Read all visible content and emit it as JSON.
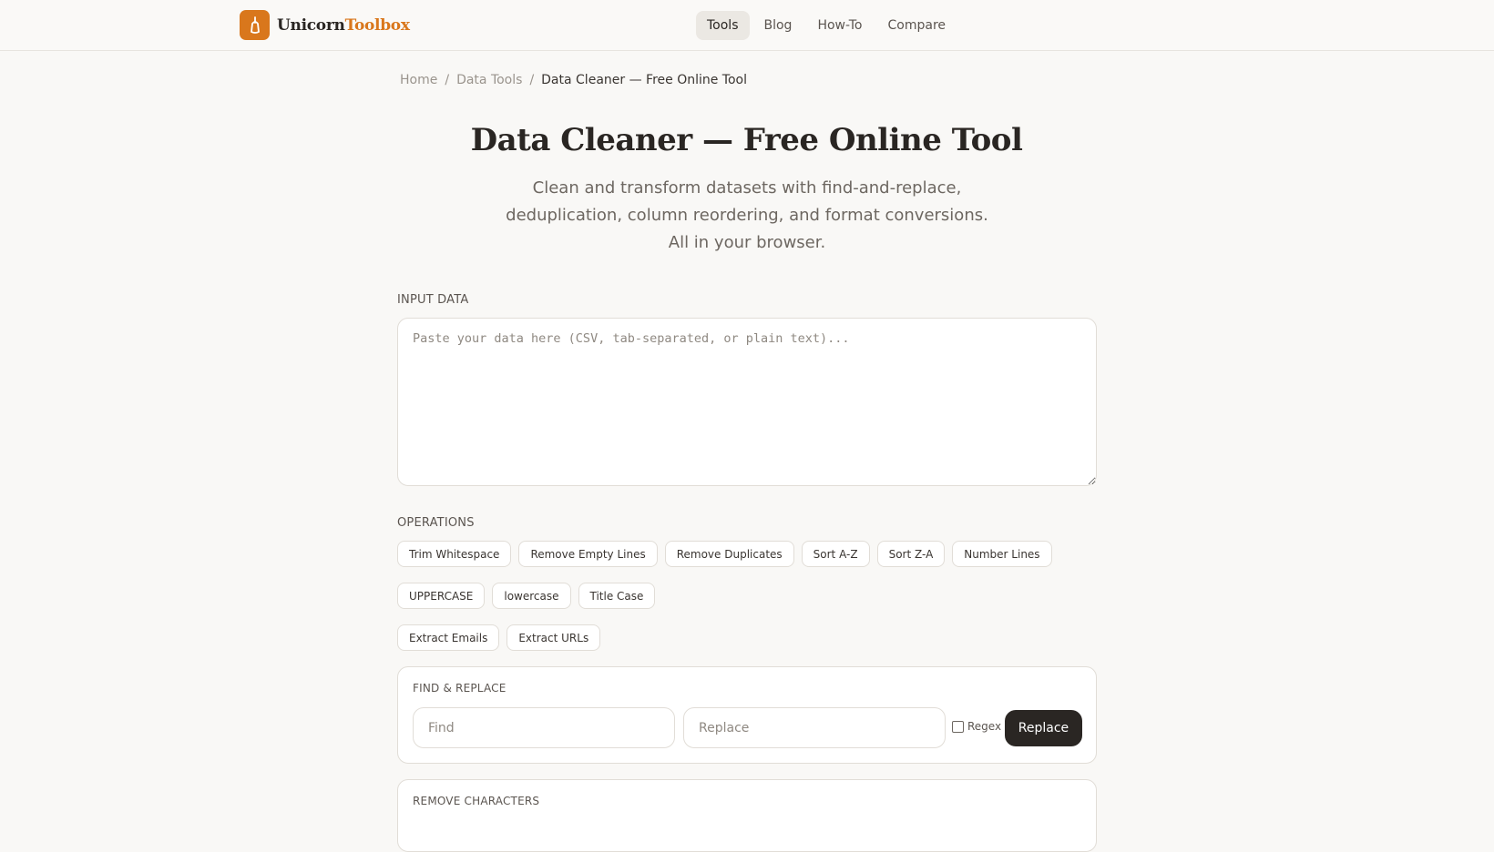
{
  "brand": {
    "name_part1": "Unicorn",
    "name_part2": "Toolbox",
    "accent": "#d9771c"
  },
  "nav": {
    "items": [
      "Tools",
      "Blog",
      "How-To",
      "Compare"
    ],
    "active": "Tools"
  },
  "breadcrumb": {
    "home": "Home",
    "sep": "/",
    "section": "Data Tools",
    "current": "Data Cleaner — Free Online Tool"
  },
  "hero": {
    "title": "Data Cleaner — Free Online Tool",
    "subtitle": "Clean and transform datasets with find-and-replace, deduplication, column reordering, and format conversions. All in your browser."
  },
  "input": {
    "label": "INPUT DATA",
    "value": "",
    "placeholder": "Paste your data here (CSV, tab-separated, or plain text)..."
  },
  "operations": {
    "label": "OPERATIONS",
    "row1": [
      "Trim Whitespace",
      "Remove Empty Lines",
      "Remove Duplicates",
      "Sort A-Z",
      "Sort Z-A",
      "Number Lines"
    ],
    "row2": [
      "UPPERCASE",
      "lowercase",
      "Title Case"
    ],
    "row3": [
      "Extract Emails",
      "Extract URLs"
    ]
  },
  "find_replace": {
    "label": "FIND & REPLACE",
    "find_value": "",
    "find_placeholder": "Find",
    "replace_value": "",
    "replace_placeholder": "Replace",
    "regex_label": "Regex",
    "regex_checked": false,
    "button": "Replace"
  },
  "remove_characters": {
    "label": "REMOVE CHARACTERS"
  }
}
